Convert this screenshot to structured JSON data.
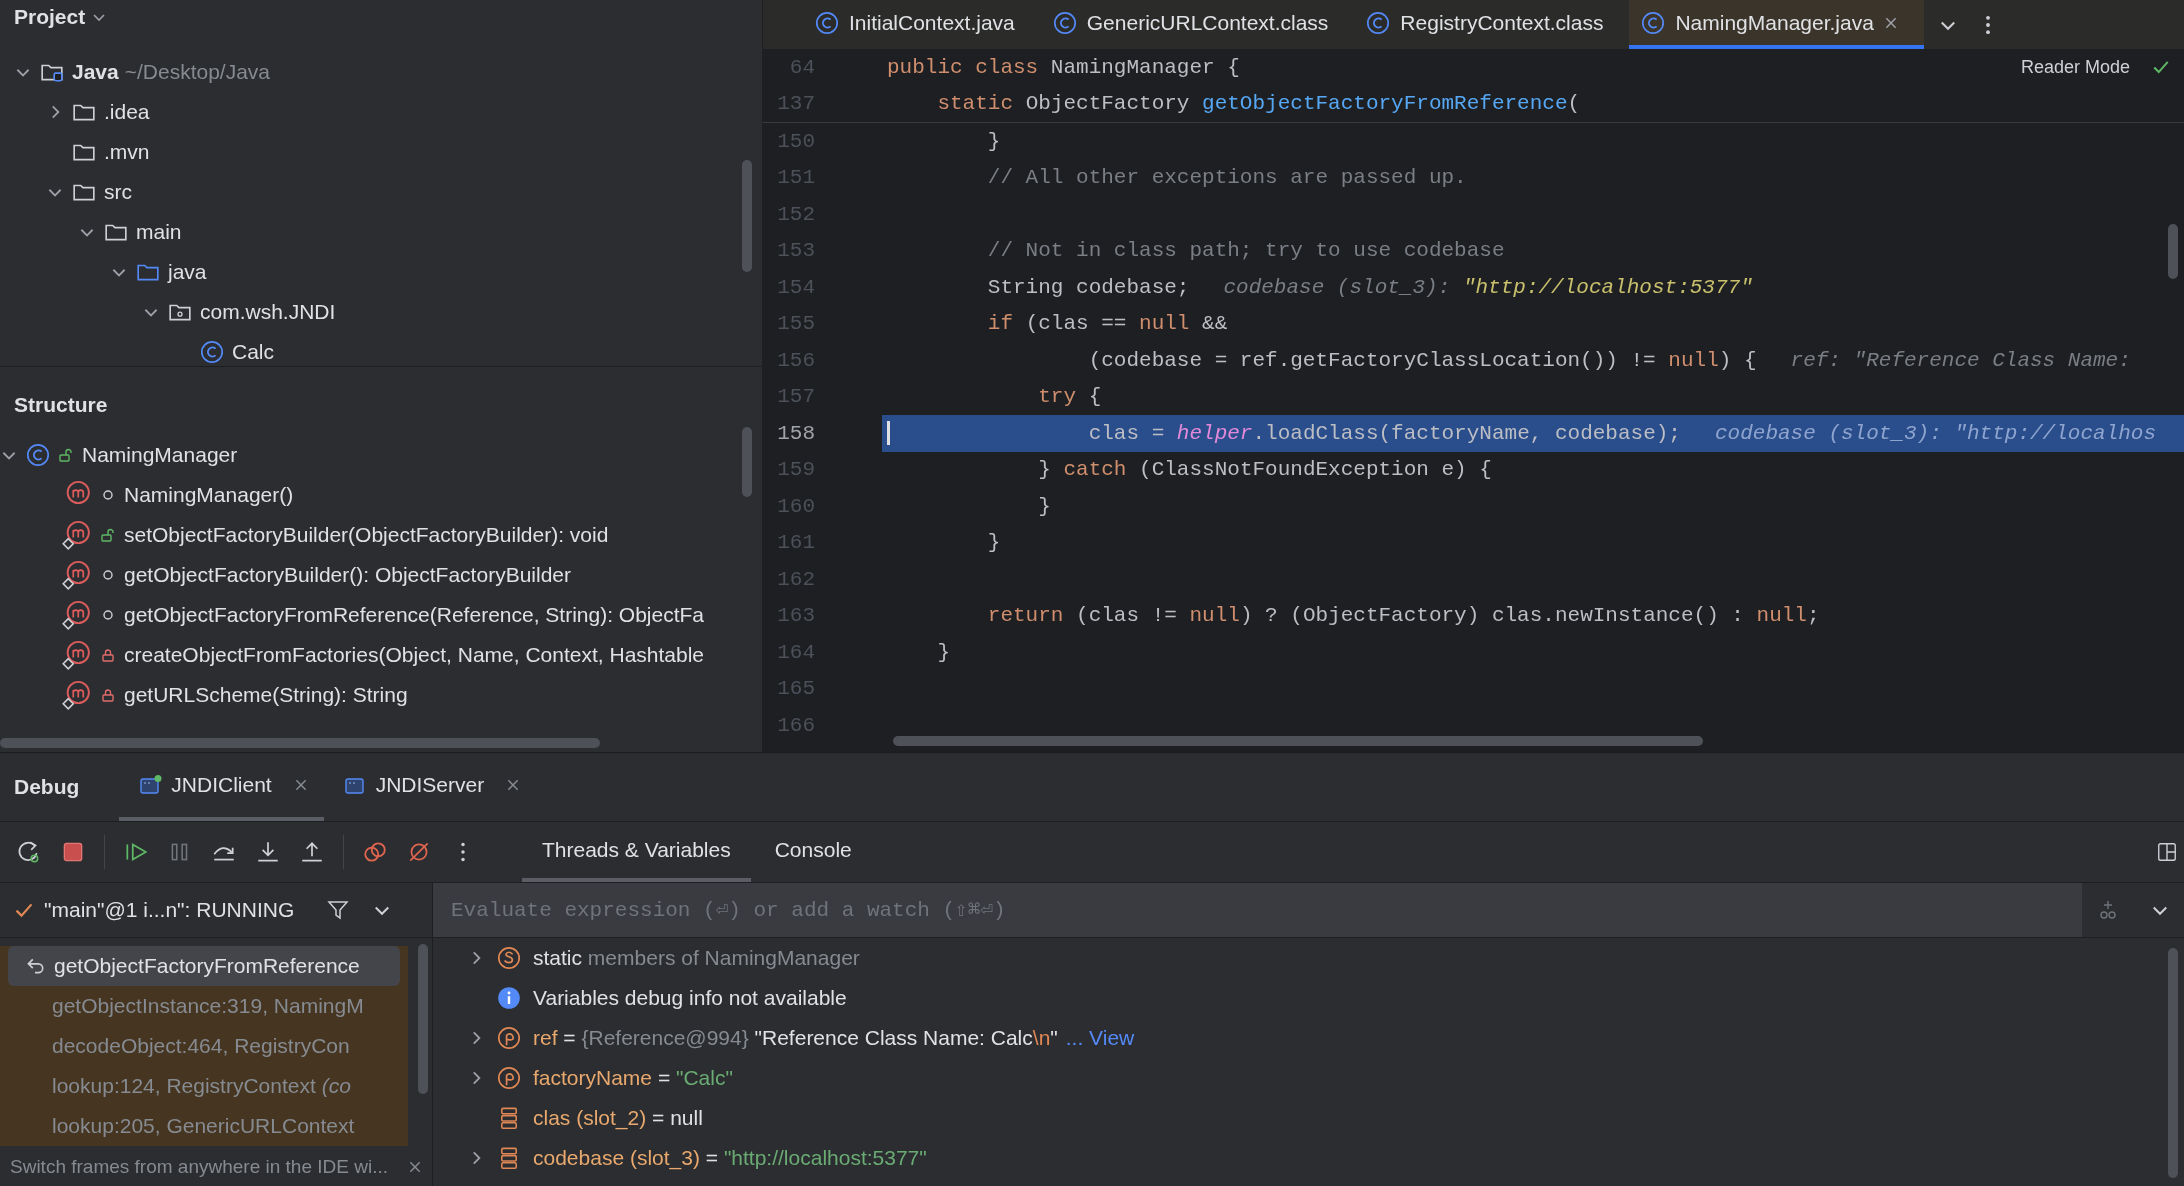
{
  "project": {
    "title": "Project",
    "tree": [
      {
        "kind": "module",
        "label": "Java",
        "path": "~/Desktop/Java",
        "expanded": true,
        "children": [
          {
            "kind": "folder",
            "label": ".idea",
            "expanded": false
          },
          {
            "kind": "folder",
            "label": ".mvn"
          },
          {
            "kind": "folder",
            "label": "src",
            "expanded": true,
            "children": [
              {
                "kind": "folder",
                "label": "main",
                "expanded": true,
                "children": [
                  {
                    "kind": "source-folder",
                    "label": "java",
                    "expanded": true,
                    "children": [
                      {
                        "kind": "package",
                        "label": "com.wsh.JNDI",
                        "expanded": true,
                        "children": [
                          {
                            "kind": "class",
                            "label": "Calc"
                          }
                        ]
                      }
                    ]
                  }
                ]
              }
            ]
          }
        ]
      }
    ]
  },
  "structure": {
    "title": "Structure",
    "root": {
      "label": "NamingManager",
      "kind": "public",
      "expanded": true
    },
    "members": [
      {
        "label": "NamingManager()",
        "kind": "package",
        "static": false
      },
      {
        "label": "setObjectFactoryBuilder(ObjectFactoryBuilder): void",
        "kind": "public",
        "static": true
      },
      {
        "label": "getObjectFactoryBuilder(): ObjectFactoryBuilder",
        "kind": "package",
        "static": true
      },
      {
        "label": "getObjectFactoryFromReference(Reference, String): ObjectFa",
        "kind": "package",
        "static": true
      },
      {
        "label": "createObjectFromFactories(Object, Name, Context, Hashtable",
        "kind": "private",
        "static": true
      },
      {
        "label": "getURLScheme(String): String",
        "kind": "private",
        "static": true
      }
    ]
  },
  "editor": {
    "tabs": [
      {
        "label": "InitialContext.java",
        "selected": false
      },
      {
        "label": "GenericURLContext.class",
        "selected": false
      },
      {
        "label": "RegistryContext.class",
        "selected": false
      },
      {
        "label": "NamingManager.java",
        "selected": true
      }
    ],
    "reader_mode": "Reader Mode",
    "sticky_lines": [
      {
        "number": "64",
        "code": [
          {
            "kind": "keyword",
            "text": "public class "
          },
          {
            "kind": "plain",
            "text": "NamingManager {"
          }
        ]
      },
      {
        "number": "137",
        "code": [
          {
            "kind": "keyword",
            "text": "    static "
          },
          {
            "kind": "plain",
            "text": "ObjectFactory "
          },
          {
            "kind": "declaration",
            "text": "getObjectFactoryFromReference"
          },
          {
            "kind": "plain",
            "text": "("
          }
        ]
      }
    ],
    "lines": [
      {
        "number": "150",
        "current": false,
        "code": [
          {
            "kind": "plain",
            "text": "        }"
          }
        ]
      },
      {
        "number": "151",
        "current": false,
        "code": [
          {
            "kind": "comment",
            "text": "        // All other exceptions are passed up."
          }
        ]
      },
      {
        "number": "152",
        "current": false
      },
      {
        "number": "153",
        "current": false,
        "code": [
          {
            "kind": "comment",
            "text": "        // Not in class path; try to use codebase"
          }
        ]
      },
      {
        "number": "154",
        "current": false,
        "code": [
          {
            "kind": "plain",
            "text": "        String codebase;"
          }
        ],
        "hint": [
          {
            "kind": "label",
            "text": "codebase (slot_3): "
          },
          {
            "kind": "string",
            "text": "\"http://localhost:5377\""
          }
        ]
      },
      {
        "number": "155",
        "current": false,
        "code": [
          {
            "kind": "keyword",
            "text": "        if "
          },
          {
            "kind": "plain",
            "text": "(clas == "
          },
          {
            "kind": "keyword",
            "text": "null "
          },
          {
            "kind": "plain",
            "text": "&&"
          }
        ]
      },
      {
        "number": "156",
        "current": false,
        "code": [
          {
            "kind": "plain",
            "text": "                (codebase = ref.getFactoryClassLocation()) != "
          },
          {
            "kind": "keyword",
            "text": "null"
          },
          {
            "kind": "plain",
            "text": ") {"
          }
        ],
        "hint": [
          {
            "kind": "label",
            "text": "ref: \"Reference Class Name:"
          }
        ]
      },
      {
        "number": "157",
        "current": false,
        "code": [
          {
            "kind": "keyword",
            "text": "            try "
          },
          {
            "kind": "plain",
            "text": "{"
          }
        ]
      },
      {
        "number": "158",
        "current": true,
        "code": [
          {
            "kind": "plain",
            "text": "                clas = "
          },
          {
            "kind": "field",
            "text": "helper"
          },
          {
            "kind": "plain",
            "text": ".loadClass(factoryName, codebase);"
          }
        ],
        "hint": [
          {
            "kind": "label",
            "text": "codebase (slot_3): \"http://localhos"
          }
        ]
      },
      {
        "number": "159",
        "current": false,
        "code": [
          {
            "kind": "plain",
            "text": "            } "
          },
          {
            "kind": "keyword",
            "text": "catch "
          },
          {
            "kind": "plain",
            "text": "(ClassNotFoundException e) {"
          }
        ]
      },
      {
        "number": "160",
        "current": false,
        "code": [
          {
            "kind": "plain",
            "text": "            }"
          }
        ]
      },
      {
        "number": "161",
        "current": false,
        "code": [
          {
            "kind": "plain",
            "text": "        }"
          }
        ]
      },
      {
        "number": "162",
        "current": false
      },
      {
        "number": "163",
        "current": false,
        "code": [
          {
            "kind": "keyword",
            "text": "        return "
          },
          {
            "kind": "plain",
            "text": "(clas != "
          },
          {
            "kind": "keyword",
            "text": "null"
          },
          {
            "kind": "plain",
            "text": ") ? (ObjectFactory) clas.newInstance() : "
          },
          {
            "kind": "keyword",
            "text": "null"
          },
          {
            "kind": "plain",
            "text": ";"
          }
        ]
      },
      {
        "number": "164",
        "current": false,
        "code": [
          {
            "kind": "plain",
            "text": "    }"
          }
        ]
      },
      {
        "number": "165",
        "current": false
      },
      {
        "number": "166",
        "current": false
      }
    ]
  },
  "debug": {
    "title": "Debug",
    "sessions": [
      {
        "label": "JNDIClient",
        "selected": true,
        "running": true
      },
      {
        "label": "JNDIServer",
        "selected": false,
        "running": false
      }
    ],
    "view_tabs": [
      {
        "label": "Threads & Variables",
        "selected": true
      },
      {
        "label": "Console",
        "selected": false
      }
    ],
    "thread": "\"main\"@1 i...n\": RUNNING",
    "frames": [
      {
        "text": "getObjectFactoryFromReference",
        "selected": true,
        "library": false
      },
      {
        "text": "getObjectInstance:319, NamingM",
        "selected": false,
        "library": true
      },
      {
        "text": "decodeObject:464, RegistryCon",
        "selected": false,
        "library": true
      },
      {
        "text": "lookup:124, RegistryContext *(co*",
        "selected": false,
        "library": true
      },
      {
        "text": "lookup:205, GenericURLContext",
        "selected": false,
        "library": true
      }
    ],
    "frames_hint": "Switch frames from anywhere in the IDE wi...",
    "evaluate": {
      "placeholder": "Evaluate expression (⏎) or add a watch (⇧⌘⏎)"
    },
    "variables": [
      {
        "kind": "static",
        "expanded": false,
        "parts": [
          {
            "kind": "plain",
            "text": "static "
          },
          {
            "kind": "muted",
            "text": "members of NamingManager"
          }
        ]
      },
      {
        "kind": "info",
        "parts": [
          {
            "kind": "plain",
            "text": "Variables debug info not available"
          }
        ]
      },
      {
        "kind": "parameter",
        "expanded": false,
        "parts": [
          {
            "kind": "name",
            "text": "ref"
          },
          {
            "kind": "plain",
            "text": " = "
          },
          {
            "kind": "muted",
            "text": "{Reference@994} "
          },
          {
            "kind": "plain",
            "text": "\"Reference Class Name: Calc"
          },
          {
            "kind": "escape",
            "text": "\\n"
          },
          {
            "kind": "plain",
            "text": "\""
          }
        ],
        "link": "... View"
      },
      {
        "kind": "parameter",
        "expanded": false,
        "parts": [
          {
            "kind": "name",
            "text": "factoryName"
          },
          {
            "kind": "plain",
            "text": " = "
          },
          {
            "kind": "string",
            "text": "\"Calc\""
          }
        ]
      },
      {
        "kind": "local",
        "parts": [
          {
            "kind": "name",
            "text": "clas (slot_2)"
          },
          {
            "kind": "plain",
            "text": " = null"
          }
        ]
      },
      {
        "kind": "local",
        "expanded": false,
        "parts": [
          {
            "kind": "name",
            "text": "codebase (slot_3)"
          },
          {
            "kind": "plain",
            "text": " = "
          },
          {
            "kind": "string",
            "text": "\"http://localhost:5377\""
          }
        ]
      }
    ]
  }
}
